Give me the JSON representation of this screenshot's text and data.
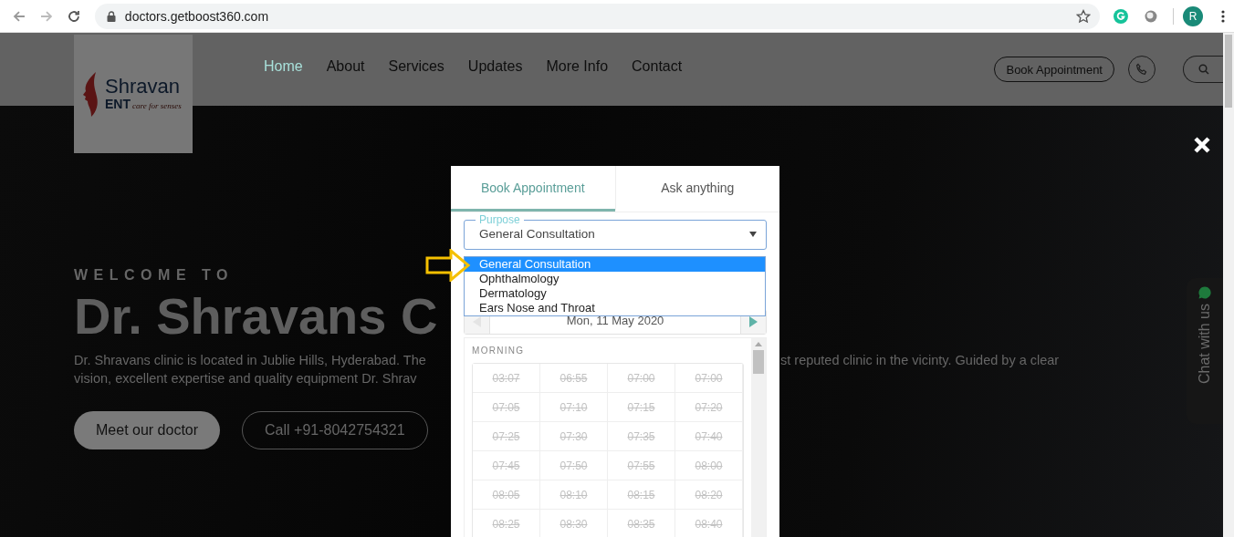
{
  "browser": {
    "url": "doctors.getboost360.com",
    "profile_initial": "R",
    "forward_disabled": true
  },
  "header": {
    "logo": {
      "name": "Shravan",
      "sub": "ENT",
      "tagline": "care for senses"
    },
    "nav": [
      {
        "label": "Home",
        "selected": true
      },
      {
        "label": "About",
        "selected": false
      },
      {
        "label": "Services",
        "selected": false
      },
      {
        "label": "Updates",
        "selected": false
      },
      {
        "label": "More Info",
        "selected": false
      },
      {
        "label": "Contact",
        "selected": false
      }
    ],
    "book_button": "Book Appointment"
  },
  "hero": {
    "welcome": "WELCOME TO",
    "title": "Dr. Shravans C",
    "paragraph_left": [
      "Dr. Shravans clinic is located in Jublie Hills, Hyderabad. The",
      "vision, excellent expertise and quality equipment Dr. Shrav"
    ],
    "paragraph_right": "st reputed clinic in the vicinty. Guided by a clear",
    "buttons": [
      {
        "label": "Meet our doctor",
        "kind": "filled"
      },
      {
        "label": "Call +91-8042754321",
        "kind": "outline"
      }
    ]
  },
  "modal": {
    "tabs": [
      {
        "label": "Book Appointment",
        "selected": true
      },
      {
        "label": "Ask anything",
        "selected": false
      }
    ],
    "purpose": {
      "label": "Purpose",
      "value": "General Consultation",
      "expanded": true,
      "options": [
        {
          "label": "General Consultation",
          "selected": true
        },
        {
          "label": "Ophthalmology",
          "selected": false
        },
        {
          "label": "Dermatology",
          "selected": false
        },
        {
          "label": "Ears Nose and Throat",
          "selected": false
        }
      ]
    },
    "date": {
      "value": "Mon, 11 May 2020",
      "prev_disabled": true,
      "next_disabled": false
    },
    "section": "MORNING",
    "slots": [
      {
        "time": "03:07",
        "disabled": true
      },
      {
        "time": "06:55",
        "disabled": true
      },
      {
        "time": "07:00",
        "disabled": true
      },
      {
        "time": "07:00",
        "disabled": true
      },
      {
        "time": "07:05",
        "disabled": true
      },
      {
        "time": "07:10",
        "disabled": true
      },
      {
        "time": "07:15",
        "disabled": true
      },
      {
        "time": "07:20",
        "disabled": true
      },
      {
        "time": "07:25",
        "disabled": true
      },
      {
        "time": "07:30",
        "disabled": true
      },
      {
        "time": "07:35",
        "disabled": true
      },
      {
        "time": "07:40",
        "disabled": true
      },
      {
        "time": "07:45",
        "disabled": true
      },
      {
        "time": "07:50",
        "disabled": true
      },
      {
        "time": "07:55",
        "disabled": true
      },
      {
        "time": "08:00",
        "disabled": true
      },
      {
        "time": "08:05",
        "disabled": true
      },
      {
        "time": "08:10",
        "disabled": true
      },
      {
        "time": "08:15",
        "disabled": true
      },
      {
        "time": "08:20",
        "disabled": true
      },
      {
        "time": "08:25",
        "disabled": true
      },
      {
        "time": "08:30",
        "disabled": true
      },
      {
        "time": "08:35",
        "disabled": true
      },
      {
        "time": "08:40",
        "disabled": true
      }
    ]
  },
  "chat": {
    "label": "Chat with us"
  }
}
